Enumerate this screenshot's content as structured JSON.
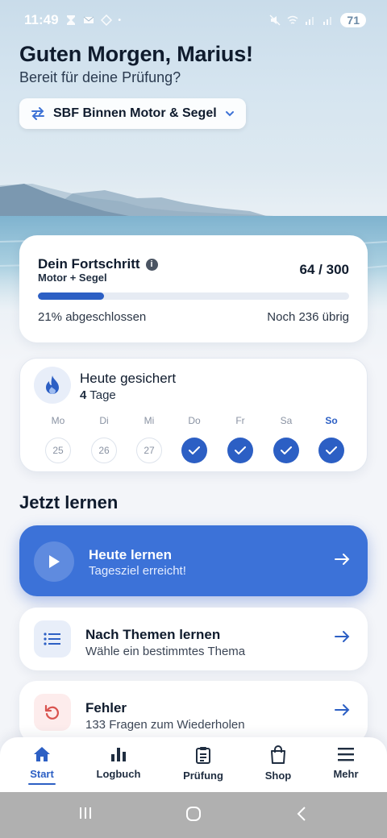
{
  "status_bar": {
    "time": "11:49",
    "battery": "71"
  },
  "header": {
    "greeting": "Guten Morgen, Marius!",
    "subtitle": "Bereit für deine Prüfung?",
    "course_selector": "SBF Binnen Motor & Segel"
  },
  "progress": {
    "title": "Dein Fortschritt",
    "subtitle": "Motor + Segel",
    "count": "64 / 300",
    "fraction": 0.213,
    "completed_text": "21% abgeschlossen",
    "remaining_text": "Noch 236 übrig"
  },
  "streak": {
    "title": "Heute gesichert",
    "days_number": "4",
    "days_unit": "Tage",
    "days": [
      {
        "label": "Mo",
        "date": "25",
        "done": false
      },
      {
        "label": "Di",
        "date": "26",
        "done": false
      },
      {
        "label": "Mi",
        "date": "27",
        "done": false
      },
      {
        "label": "Do",
        "date": "",
        "done": true
      },
      {
        "label": "Fr",
        "date": "",
        "done": true
      },
      {
        "label": "Sa",
        "date": "",
        "done": true
      },
      {
        "label": "So",
        "date": "",
        "done": true
      }
    ]
  },
  "learn": {
    "section_title": "Jetzt lernen",
    "today": {
      "title": "Heute lernen",
      "subtitle": "Tagesziel erreicht!"
    },
    "topics": {
      "title": "Nach Themen lernen",
      "subtitle": "Wähle ein bestimmtes Thema"
    },
    "mistakes": {
      "title": "Fehler",
      "subtitle": "133 Fragen zum Wiederholen"
    }
  },
  "bottom_nav": {
    "items": [
      {
        "label": "Start",
        "icon": "home-icon",
        "active": true
      },
      {
        "label": "Logbuch",
        "icon": "bar-chart-icon",
        "active": false
      },
      {
        "label": "Prüfung",
        "icon": "clipboard-icon",
        "active": false
      },
      {
        "label": "Shop",
        "icon": "shopping-bag-icon",
        "active": false
      },
      {
        "label": "Mehr",
        "icon": "menu-icon",
        "active": false
      }
    ]
  },
  "colors": {
    "accent": "#3c72d8",
    "accent_dark": "#2c5fc4",
    "mistake": "#d9534f"
  }
}
